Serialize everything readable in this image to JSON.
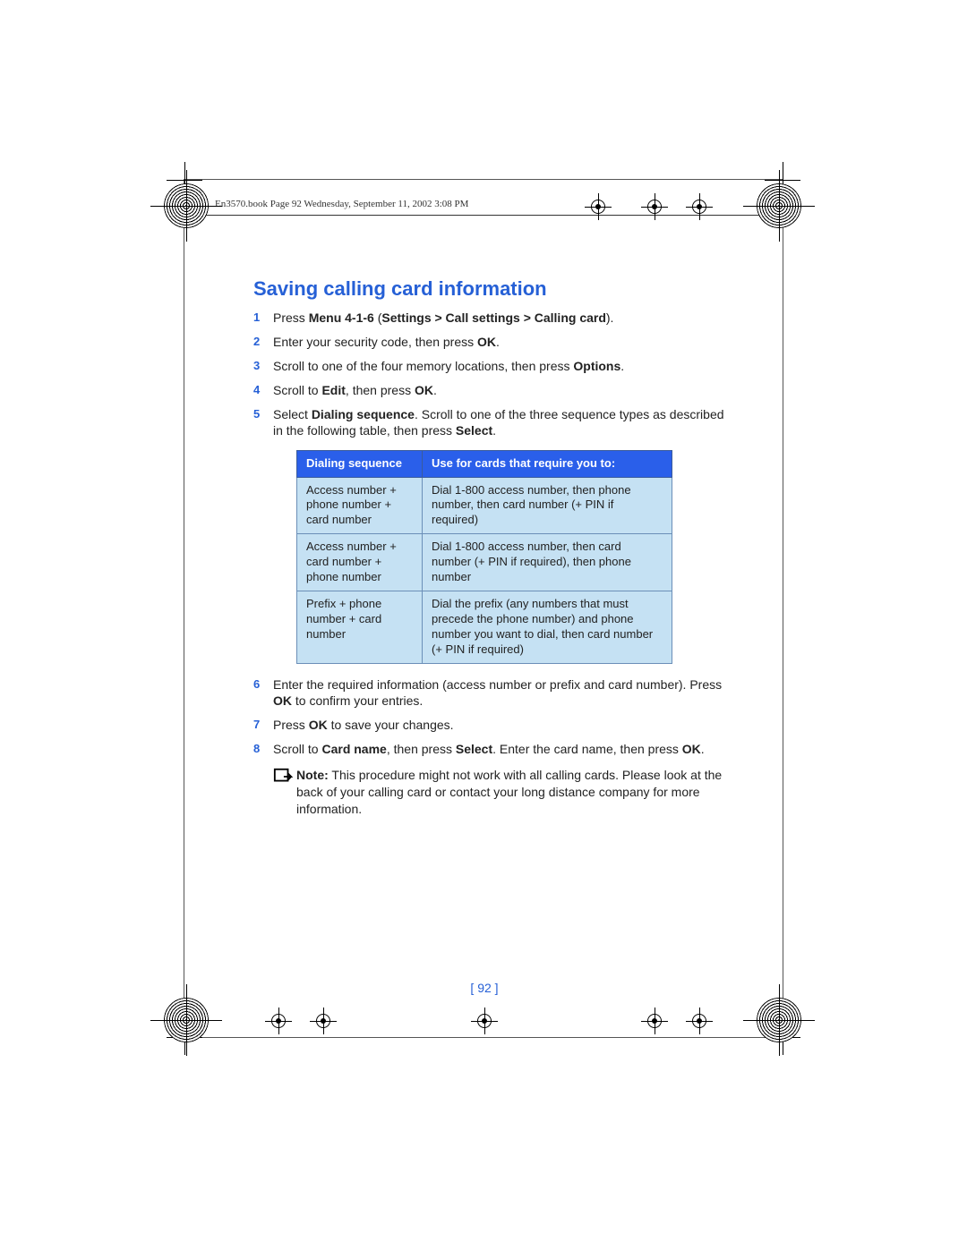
{
  "header_line": "En3570.book  Page 92  Wednesday, September 11, 2002  3:08 PM",
  "title": "Saving calling card information",
  "steps_a": [
    {
      "n": "1",
      "segs": [
        {
          "t": "Press "
        },
        {
          "b": "Menu 4-1-6"
        },
        {
          "t": " ("
        },
        {
          "b": "Settings > Call settings > Calling card"
        },
        {
          "t": ")."
        }
      ]
    },
    {
      "n": "2",
      "segs": [
        {
          "t": "Enter your security code, then press "
        },
        {
          "b": "OK"
        },
        {
          "t": "."
        }
      ]
    },
    {
      "n": "3",
      "segs": [
        {
          "t": "Scroll to one of the four memory locations, then press "
        },
        {
          "b": "Options"
        },
        {
          "t": "."
        }
      ]
    },
    {
      "n": "4",
      "segs": [
        {
          "t": "Scroll to "
        },
        {
          "b": "Edit"
        },
        {
          "t": ", then press "
        },
        {
          "b": "OK"
        },
        {
          "t": "."
        }
      ]
    },
    {
      "n": "5",
      "segs": [
        {
          "t": "Select "
        },
        {
          "b": "Dialing sequence"
        },
        {
          "t": ". Scroll to one of the three sequence types as described in the following table, then press "
        },
        {
          "b": "Select"
        },
        {
          "t": "."
        }
      ]
    }
  ],
  "table": {
    "head": [
      "Dialing sequence",
      "Use for cards that require you to:"
    ],
    "rows": [
      [
        "Access number + phone number + card number",
        "Dial 1-800 access number, then phone number, then card number (+ PIN if required)"
      ],
      [
        "Access number + card number + phone number",
        "Dial 1-800 access number, then card number (+ PIN if required), then phone number"
      ],
      [
        "Prefix + phone number + card number",
        "Dial the prefix (any numbers that must precede the phone number) and phone number you want to dial, then card number (+ PIN if required)"
      ]
    ]
  },
  "steps_b": [
    {
      "n": "6",
      "segs": [
        {
          "t": "Enter the required information (access number or prefix and card number). Press "
        },
        {
          "b": "OK"
        },
        {
          "t": " to confirm your entries."
        }
      ]
    },
    {
      "n": "7",
      "segs": [
        {
          "t": "Press "
        },
        {
          "b": "OK"
        },
        {
          "t": " to save your changes."
        }
      ]
    },
    {
      "n": "8",
      "segs": [
        {
          "t": "Scroll to "
        },
        {
          "b": "Card name"
        },
        {
          "t": ", then press "
        },
        {
          "b": "Select"
        },
        {
          "t": ". Enter the card name, then press "
        },
        {
          "b": "OK"
        },
        {
          "t": "."
        }
      ]
    }
  ],
  "note": {
    "segs": [
      {
        "b": "Note:"
      },
      {
        "t": " This procedure might not work with all calling cards. Please look at the back of your calling card or contact your long distance company for more information."
      }
    ]
  },
  "page_number_display": "[ 92 ]"
}
